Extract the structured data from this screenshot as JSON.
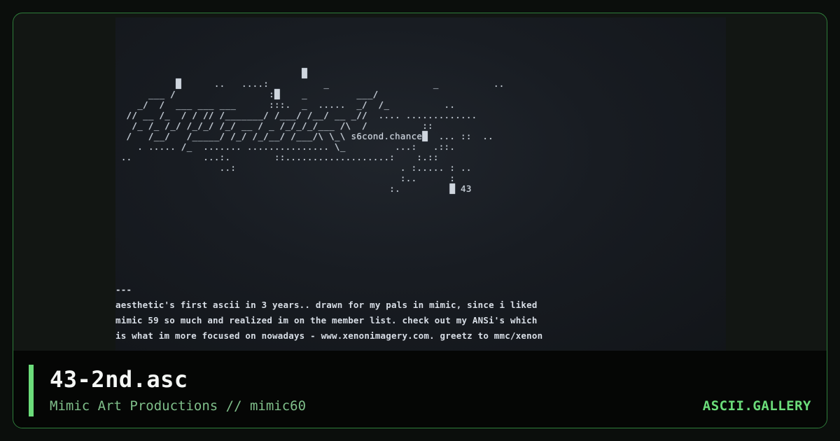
{
  "artwork": {
    "ascii_art": "                                  █                                    \n           █      ..   ....:          _                   _          .. \n      ___ /                 :█    _         ___/          \n    _/  /  ___ ___ ___      :::.  _  .....  _/  /_          ..  \n  // __ /_  / / // /_______/ /___/ /__/ __ _//  .... ............. \n   /_ /_ /_/ /_/_/ /_/ __ / _ /_/_/_/___ /\\  /          :: \n  /   /__/   /_____/ /_/ /_/__/ /___/\\ \\_\\ s6cond.chance█  ... ::  .. \n    . ..... /_  ....... ............... \\_         ...:   .::. \n ..             ...:.        ::...................:    :.:: \n                   ..:                              . :..... : .. \n                                                    :..      : \n                                                  :.         █ 43",
    "caption": "---\naesthetic's first ascii in 3 years.. drawn for my pals in mimic, since i liked\nmimic 59 so much and realized im on the member list. check out my ANSi's which\nis what im more focused on nowadays - www.xenonimagery.com. greetz to mmc/xenon"
  },
  "info": {
    "title": "43-2nd.asc",
    "subtitle": "Mimic Art Productions // mimic60",
    "brand": "ASCII.GALLERY"
  },
  "colors": {
    "accent": "#6bdc7a",
    "border": "#2e7d3a",
    "background": "#0b0e0c"
  }
}
